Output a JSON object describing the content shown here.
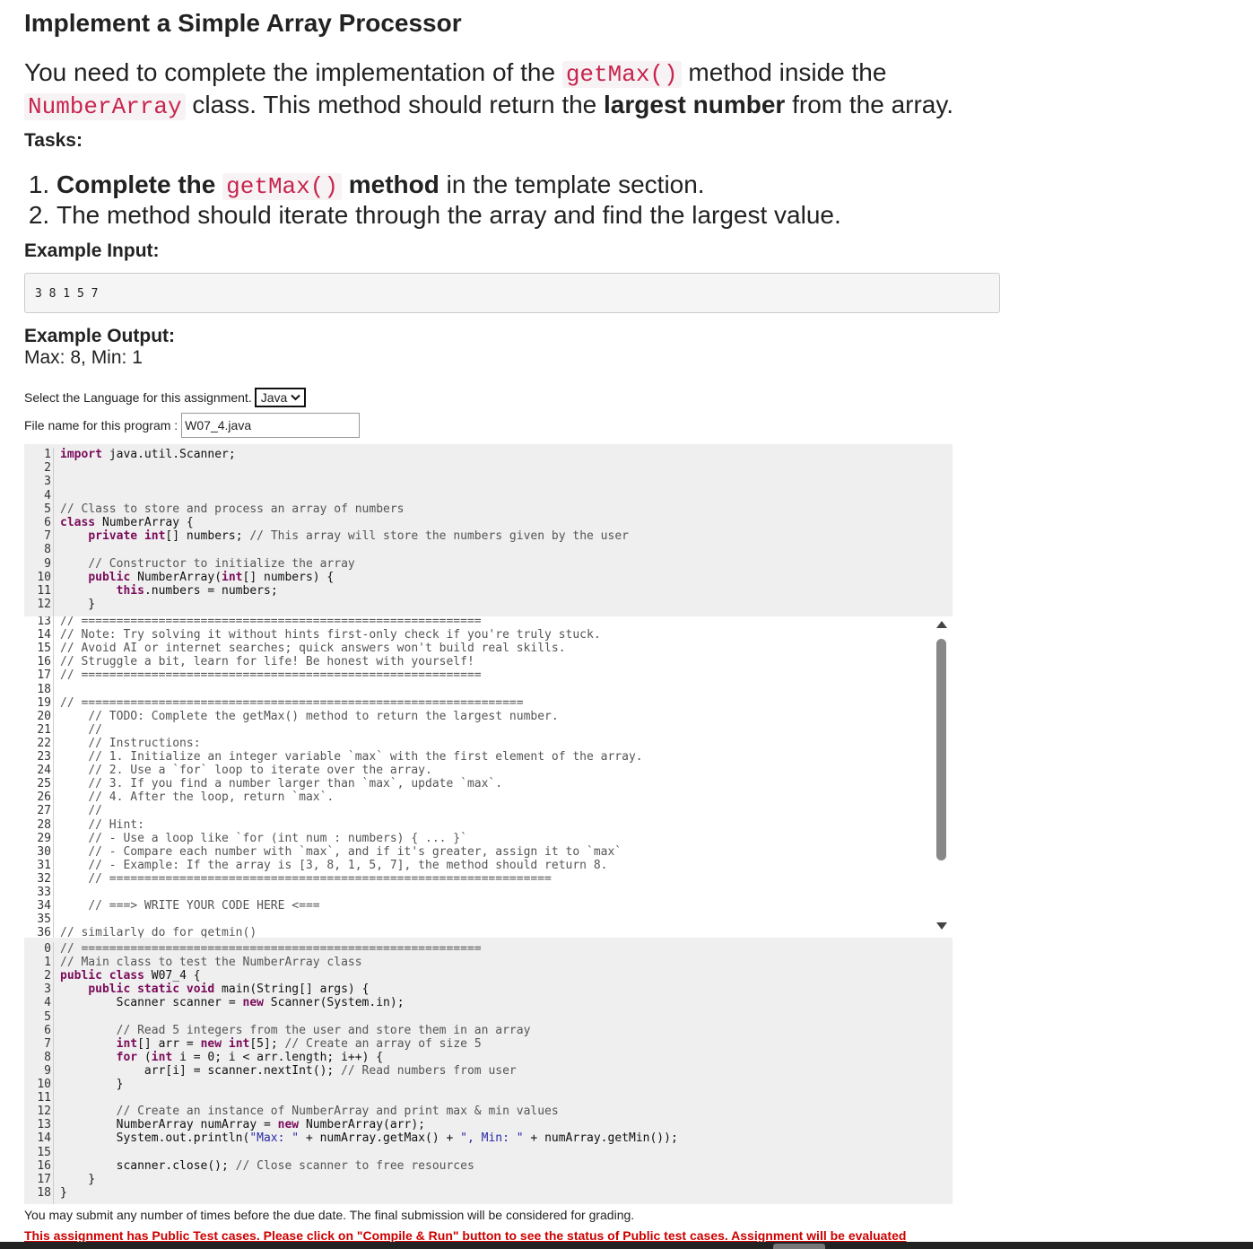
{
  "title": "Implement a Simple Array Processor",
  "intro": {
    "p1": "You need to complete the implementation of the ",
    "code1": "getMax()",
    "p2": " method inside the ",
    "code2": "NumberArray",
    "p3": " class. This method should return the ",
    "bold": "largest number",
    "p4": " from the array."
  },
  "tasks_heading": "Tasks:",
  "tasks": {
    "t1_bold1": "Complete the ",
    "t1_code": "getMax()",
    "t1_bold2": " method",
    "t1_rest": " in the template section.",
    "t2": "The method should iterate through the array and find the largest value."
  },
  "example_input_heading": "Example Input:",
  "example_input": "3 8 1 5 7",
  "example_output_heading": "Example Output:",
  "example_output": "Max: 8, Min: 1",
  "language": {
    "label": "Select the Language for this assignment.",
    "selected": "Java"
  },
  "file": {
    "label": "File name for this program :",
    "value": "W07_4.java"
  },
  "editor": {
    "top_lines": [
      "import java.util.Scanner;",
      "",
      "",
      "",
      "// Class to store and process an array of numbers",
      "class NumberArray {",
      "    private int[] numbers; // This array will store the numbers given by the user",
      "",
      "    // Constructor to initialize the array",
      "    public NumberArray(int[] numbers) {",
      "        this.numbers = numbers;",
      "    }"
    ],
    "mid_lines": [
      "// =========================================================",
      "// Note: Try solving it without hints first-only check if you're truly stuck.",
      "// Avoid AI or internet searches; quick answers won't build real skills.",
      "// Struggle a bit, learn for life! Be honest with yourself!",
      "// =========================================================",
      "",
      "// ===============================================================",
      "    // TODO: Complete the getMax() method to return the largest number.",
      "    //",
      "    // Instructions:",
      "    // 1. Initialize an integer variable `max` with the first element of the array.",
      "    // 2. Use a `for` loop to iterate over the array.",
      "    // 3. If you find a number larger than `max`, update `max`.",
      "    // 4. After the loop, return `max`.",
      "    //",
      "    // Hint:",
      "    // - Use a loop like `for (int num : numbers) { ... }`",
      "    // - Compare each number with `max`, and if it's greater, assign it to `max`",
      "    // - Example: If the array is [3, 8, 1, 5, 7], the method should return 8.",
      "    // ===============================================================",
      "",
      "    // ===> WRITE YOUR CODE HERE <===",
      "",
      "// similarly do for getmin()"
    ],
    "bottom_lines": [
      "// =========================================================",
      "// Main class to test the NumberArray class",
      "public class W07_4 {",
      "    public static void main(String[] args) {",
      "        Scanner scanner = new Scanner(System.in);",
      "",
      "        // Read 5 integers from the user and store them in an array",
      "        int[] arr = new int[5]; // Create an array of size 5",
      "        for (int i = 0; i < arr.length; i++) {",
      "            arr[i] = scanner.nextInt(); // Read numbers from user",
      "        }",
      "",
      "        // Create an instance of NumberArray and print max & min values",
      "        NumberArray numArray = new NumberArray(arr);",
      "        System.out.println(\"Max: \" + numArray.getMax() + \", Min: \" + numArray.getMin());",
      "",
      "        scanner.close(); // Close scanner to free resources",
      "    }",
      "}"
    ]
  },
  "note1": "You may submit any number of times before the due date. The final submission will be considered for grading.",
  "note2": "This assignment has Public Test cases. Please click on \"Compile & Run\" button to see the status of Public test cases. Assignment will be evaluated"
}
